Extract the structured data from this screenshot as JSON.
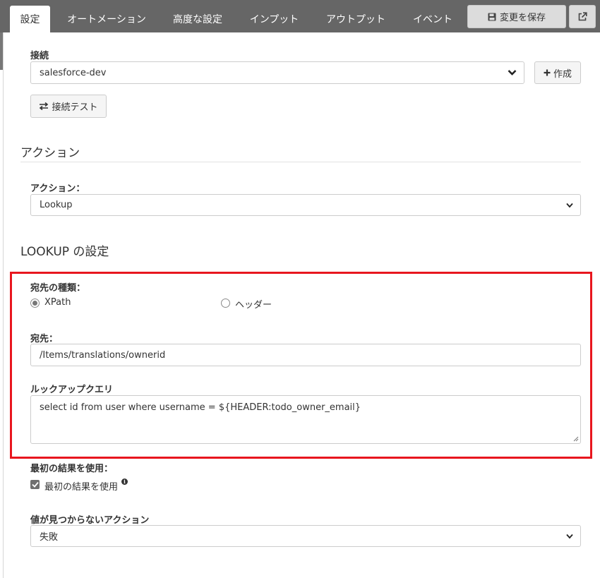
{
  "tabs": [
    {
      "label": "設定",
      "active": true
    },
    {
      "label": "オートメーション"
    },
    {
      "label": "高度な設定"
    },
    {
      "label": "インプット"
    },
    {
      "label": "アウトプット"
    },
    {
      "label": "イベント"
    }
  ],
  "toolbar": {
    "save_label": "変更を保存",
    "save_icon": "floppy-icon",
    "external_icon": "external-link-icon"
  },
  "connection": {
    "label": "接続",
    "value": "salesforce-dev",
    "create_label": "作成",
    "test_label": "接続テスト"
  },
  "action_section": {
    "title": "アクション",
    "action_label": "アクション：",
    "action_value": "Lookup"
  },
  "lookup_section": {
    "title": "LOOKUP の設定",
    "dest_type_label": "宛先の種類：",
    "dest_type_options": [
      "XPath",
      "ヘッダー"
    ],
    "dest_type_selected": "XPath",
    "dest_label": "宛先：",
    "dest_value": "/Items/translations/ownerid",
    "query_label": "ルックアップクエリ",
    "query_value": "select id from user where username = ${HEADER:todo_owner_email}",
    "first_result_label": "最初の結果を使用：",
    "first_result_checkbox_label": "最初の結果を使用",
    "first_result_checked": true,
    "not_found_label": "値が見つからないアクション",
    "not_found_value": "失敗"
  },
  "colors": {
    "highlight": "#e8161e",
    "topbar": "#666666"
  }
}
